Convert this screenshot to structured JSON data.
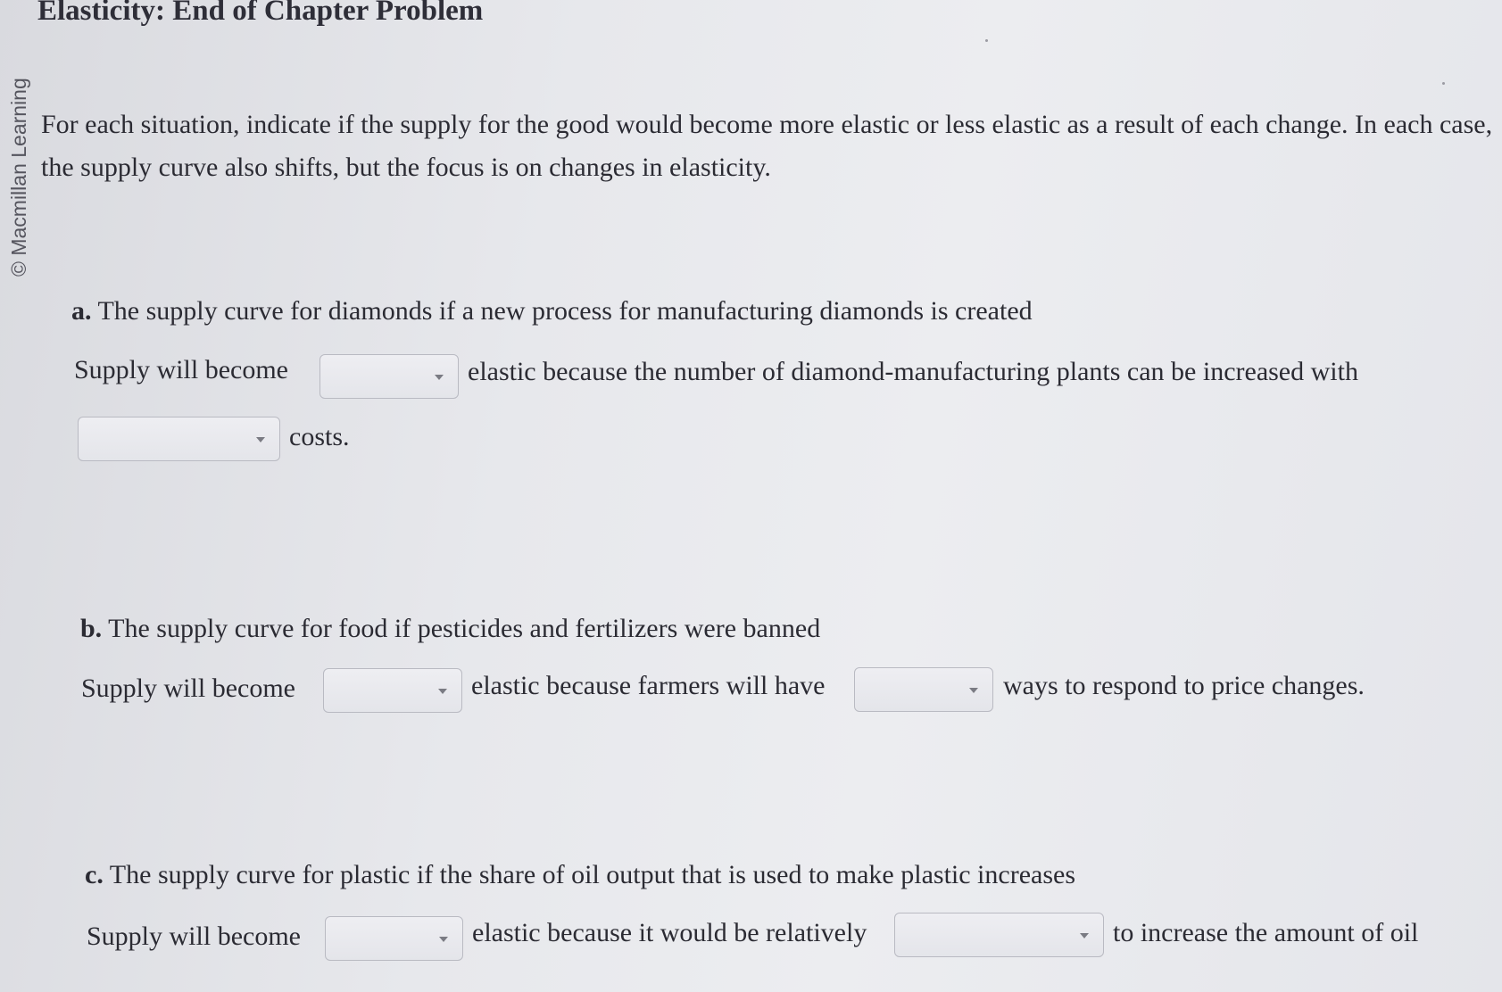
{
  "page": {
    "title": "Elasticity: End of Chapter Problem",
    "copyright": "© Macmillan Learning",
    "intro": "For each situation, indicate if the supply for the good would become more elastic or less elastic as a result of each change. In each case, the supply curve also shifts, but the focus is on changes in elasticity."
  },
  "questions": [
    {
      "letter": "a.",
      "prompt": "The supply curve for diamonds if a new process for manufacturing diamonds is created",
      "lead": "Supply will become",
      "mid": "elastic because the number of diamond-manufacturing plants can be increased with",
      "tail": "costs.",
      "dropdown1_value": "",
      "dropdown2_value": ""
    },
    {
      "letter": "b.",
      "prompt": "The supply curve for food if pesticides and fertilizers were banned",
      "lead": "Supply will become",
      "mid": "elastic because farmers will have",
      "tail": "ways to respond to price changes.",
      "dropdown1_value": "",
      "dropdown2_value": ""
    },
    {
      "letter": "c.",
      "prompt": "The supply curve for plastic if the share of oil output that is used to make plastic increases",
      "lead": "Supply will become",
      "mid": "elastic because it would be relatively",
      "tail": "to increase the amount of oil",
      "dropdown1_value": "",
      "dropdown2_value": ""
    }
  ]
}
